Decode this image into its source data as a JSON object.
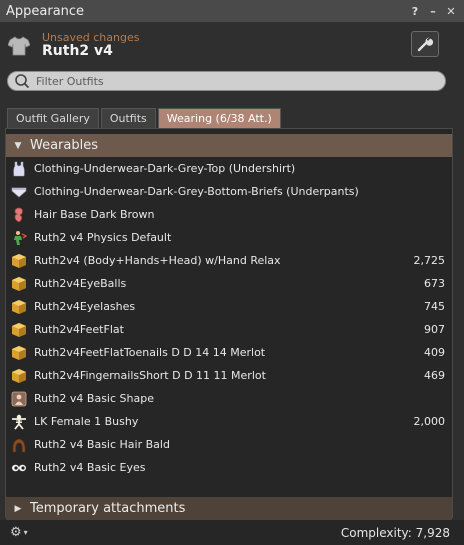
{
  "window": {
    "title": "Appearance"
  },
  "header": {
    "status": "Unsaved changes",
    "outfit_name": "Ruth2 v4"
  },
  "filter": {
    "placeholder": "Filter Outfits"
  },
  "tabs": [
    {
      "label": "Outfit Gallery",
      "active": false
    },
    {
      "label": "Outfits",
      "active": false
    },
    {
      "label": "Wearing (6/38 Att.)",
      "active": true
    }
  ],
  "sections": {
    "wearables": "Wearables",
    "temporary": "Temporary attachments"
  },
  "items": [
    {
      "icon": "undershirt-icon",
      "label": "Clothing-Underwear-Dark-Grey-Top (Undershirt)",
      "value": ""
    },
    {
      "icon": "underpants-icon",
      "label": "Clothing-Underwear-Dark-Grey-Bottom-Briefs (Underpants)",
      "value": ""
    },
    {
      "icon": "hair-base-icon",
      "label": "Hair Base Dark Brown",
      "value": ""
    },
    {
      "icon": "physics-icon",
      "label": "Ruth2 v4 Physics Default",
      "value": ""
    },
    {
      "icon": "object-box-icon",
      "label": "Ruth2v4 (Body+Hands+Head) w/Hand Relax",
      "value": "2,725"
    },
    {
      "icon": "object-box-icon",
      "label": "Ruth2v4EyeBalls",
      "value": "673"
    },
    {
      "icon": "object-box-icon",
      "label": "Ruth2v4Eyelashes",
      "value": "745"
    },
    {
      "icon": "object-box-icon",
      "label": "Ruth2v4FeetFlat",
      "value": "907"
    },
    {
      "icon": "object-box-icon",
      "label": "Ruth2v4FeetFlatToenails D D 14 14 Merlot",
      "value": "409"
    },
    {
      "icon": "object-box-icon",
      "label": "Ruth2v4FingernailsShort  D D 11 11 Merlot",
      "value": "469"
    },
    {
      "icon": "shape-icon",
      "label": "Ruth2 v4 Basic Shape",
      "value": ""
    },
    {
      "icon": "skeleton-icon",
      "label": "LK Female 1 Bushy",
      "value": "2,000"
    },
    {
      "icon": "hair-icon",
      "label": "Ruth2 v4 Basic Hair Bald",
      "value": ""
    },
    {
      "icon": "eyes-icon",
      "label": "Ruth2 v4 Basic Eyes",
      "value": ""
    }
  ],
  "footer": {
    "complexity": "Complexity: 7,928"
  }
}
